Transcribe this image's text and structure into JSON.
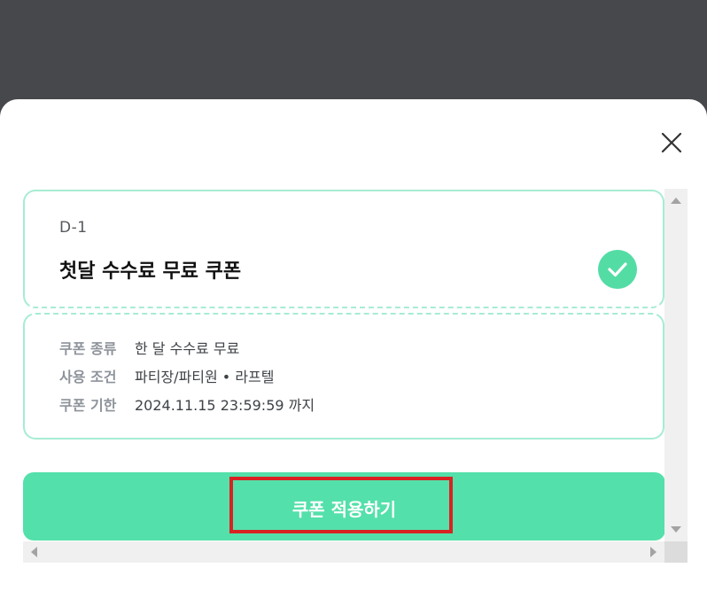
{
  "modal": {
    "close_icon": "close-icon"
  },
  "coupon": {
    "dday": "D-1",
    "title": "첫달 수수료 무료 쿠폰",
    "selected_icon": "check-circle-icon",
    "accent_color": "#54dca5",
    "border_color": "#a7ecd3",
    "details": [
      {
        "label": "쿠폰 종류",
        "value": "한 달 수수료 무료"
      },
      {
        "label": "사용 조건",
        "value": "파티장/파티원 • 라프텔"
      },
      {
        "label": "쿠폰 기한",
        "value": "2024.11.15 23:59:59 까지"
      }
    ]
  },
  "apply_button": {
    "label": "쿠폰 적용하기",
    "color": "#54e0aa",
    "highlight_color": "#d82323"
  }
}
